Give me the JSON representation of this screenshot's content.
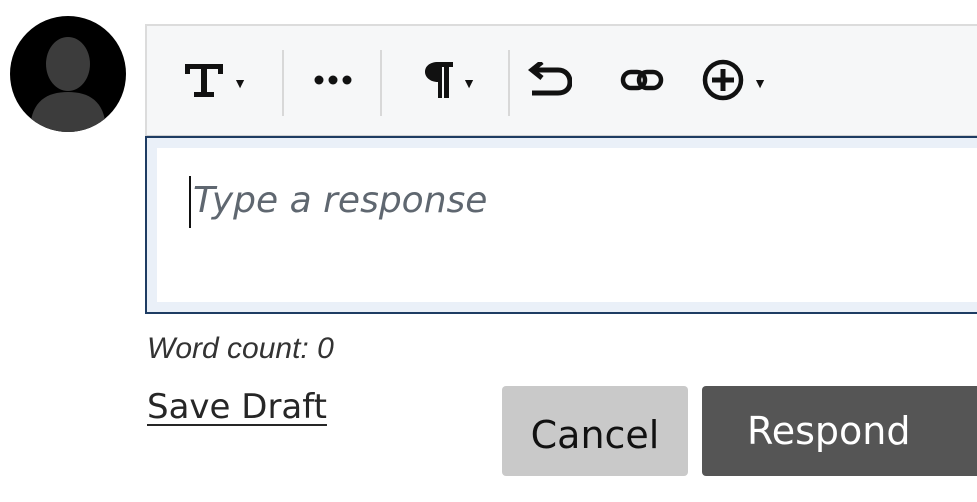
{
  "toolbar": {
    "items": [
      {
        "name": "text-format-button",
        "icon": "text-style-icon",
        "has_dropdown": true
      },
      {
        "name": "more-options-button",
        "icon": "ellipsis-icon",
        "has_dropdown": false
      },
      {
        "name": "paragraph-format-button",
        "icon": "pilcrow-icon",
        "has_dropdown": true
      },
      {
        "name": "undo-button",
        "icon": "undo-icon",
        "has_dropdown": false
      },
      {
        "name": "insert-link-button",
        "icon": "link-icon",
        "has_dropdown": false
      },
      {
        "name": "insert-content-button",
        "icon": "plus-circle-icon",
        "has_dropdown": true
      }
    ]
  },
  "editor": {
    "placeholder": "Type a response"
  },
  "word_count": "Word count: 0",
  "actions": {
    "save_draft": "Save Draft",
    "cancel": "Cancel",
    "respond": "Respond"
  },
  "colors": {
    "avatar_bg": "#000000",
    "avatar_silhouette": "#3c3c3c",
    "editor_focus_border": "#1e3c63",
    "cancel_bg": "#c9c9c9",
    "respond_bg": "#555555"
  }
}
